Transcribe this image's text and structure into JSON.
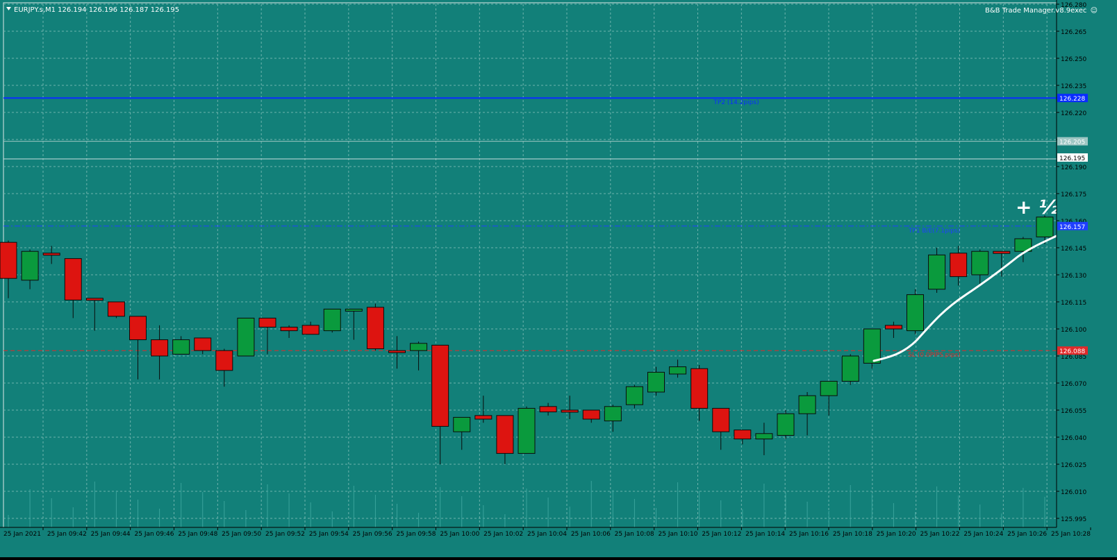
{
  "header": {
    "symbol_info": "EURJPY.s,M1  126.194 126.196 126.187 126.195",
    "ea_label": "B&B Trade Manager.v8.9exec",
    "smiley": "☺"
  },
  "colors": {
    "background": "#128079",
    "grid": "#6fb3ad",
    "bull": "#0a9a3d",
    "bear": "#dd1410",
    "wick": "#0a0a0a",
    "tp2_line": "#0a2cff",
    "tp1_line": "#1f3fff",
    "sl_line": "#e02a2a",
    "axis_text": "#000000",
    "pen": "#ffffff"
  },
  "chart_data": {
    "type": "candlestick",
    "symbol": "EURJPY.s",
    "timeframe": "M1",
    "ylim": [
      125.99,
      126.28
    ],
    "y_ticks": [
      "126.280",
      "126.265",
      "126.250",
      "126.235",
      "126.220",
      "126.205",
      "126.190",
      "126.175",
      "126.160",
      "126.145",
      "126.130",
      "126.115",
      "126.100",
      "126.085",
      "126.070",
      "126.055",
      "126.040",
      "126.025",
      "126.010",
      "125.995"
    ],
    "x_labels": [
      "25 Jan 2021",
      "25 Jan 09:42",
      "25 Jan 09:44",
      "25 Jan 09:46",
      "25 Jan 09:48",
      "25 Jan 09:50",
      "25 Jan 09:52",
      "25 Jan 09:54",
      "25 Jan 09:56",
      "25 Jan 09:58",
      "25 Jan 10:00",
      "25 Jan 10:02",
      "25 Jan 10:04",
      "25 Jan 10:06",
      "25 Jan 10:08",
      "25 Jan 10:10",
      "25 Jan 10:12",
      "25 Jan 10:14",
      "25 Jan 10:16",
      "25 Jan 10:18",
      "25 Jan 10:20",
      "25 Jan 10:22",
      "25 Jan 10:24",
      "25 Jan 10:26",
      "25 Jan 10:28"
    ],
    "candles": [
      {
        "o": 126.148,
        "h": 126.149,
        "l": 126.117,
        "c": 126.128
      },
      {
        "o": 126.127,
        "h": 126.144,
        "l": 126.122,
        "c": 126.143
      },
      {
        "o": 126.142,
        "h": 126.146,
        "l": 126.136,
        "c": 126.141
      },
      {
        "o": 126.139,
        "h": 126.139,
        "l": 126.106,
        "c": 126.116
      },
      {
        "o": 126.117,
        "h": 126.117,
        "l": 126.099,
        "c": 126.116
      },
      {
        "o": 126.115,
        "h": 126.115,
        "l": 126.106,
        "c": 126.107
      },
      {
        "o": 126.107,
        "h": 126.107,
        "l": 126.072,
        "c": 126.094
      },
      {
        "o": 126.094,
        "h": 126.102,
        "l": 126.072,
        "c": 126.085
      },
      {
        "o": 126.086,
        "h": 126.096,
        "l": 126.086,
        "c": 126.094
      },
      {
        "o": 126.095,
        "h": 126.095,
        "l": 126.086,
        "c": 126.088
      },
      {
        "o": 126.088,
        "h": 126.089,
        "l": 126.068,
        "c": 126.077
      },
      {
        "o": 126.085,
        "h": 126.106,
        "l": 126.085,
        "c": 126.106
      },
      {
        "o": 126.106,
        "h": 126.106,
        "l": 126.086,
        "c": 126.101
      },
      {
        "o": 126.101,
        "h": 126.102,
        "l": 126.095,
        "c": 126.099
      },
      {
        "o": 126.102,
        "h": 126.104,
        "l": 126.097,
        "c": 126.097
      },
      {
        "o": 126.099,
        "h": 126.111,
        "l": 126.098,
        "c": 126.111
      },
      {
        "o": 126.111,
        "h": 126.111,
        "l": 126.094,
        "c": 126.111
      },
      {
        "o": 126.112,
        "h": 126.114,
        "l": 126.088,
        "c": 126.089
      },
      {
        "o": 126.088,
        "h": 126.096,
        "l": 126.078,
        "c": 126.087
      },
      {
        "o": 126.088,
        "h": 126.093,
        "l": 126.077,
        "c": 126.092
      },
      {
        "o": 126.091,
        "h": 126.091,
        "l": 126.025,
        "c": 126.046
      },
      {
        "o": 126.043,
        "h": 126.051,
        "l": 126.033,
        "c": 126.051
      },
      {
        "o": 126.052,
        "h": 126.063,
        "l": 126.048,
        "c": 126.05
      },
      {
        "o": 126.052,
        "h": 126.052,
        "l": 126.025,
        "c": 126.031
      },
      {
        "o": 126.031,
        "h": 126.057,
        "l": 126.031,
        "c": 126.056
      },
      {
        "o": 126.057,
        "h": 126.059,
        "l": 126.052,
        "c": 126.054
      },
      {
        "o": 126.055,
        "h": 126.063,
        "l": 126.05,
        "c": 126.054
      },
      {
        "o": 126.055,
        "h": 126.055,
        "l": 126.048,
        "c": 126.05
      },
      {
        "o": 126.049,
        "h": 126.058,
        "l": 126.043,
        "c": 126.057
      },
      {
        "o": 126.058,
        "h": 126.069,
        "l": 126.056,
        "c": 126.068
      },
      {
        "o": 126.065,
        "h": 126.079,
        "l": 126.063,
        "c": 126.076
      },
      {
        "o": 126.075,
        "h": 126.083,
        "l": 126.073,
        "c": 126.079
      },
      {
        "o": 126.078,
        "h": 126.08,
        "l": 126.049,
        "c": 126.056
      },
      {
        "o": 126.056,
        "h": 126.056,
        "l": 126.033,
        "c": 126.043
      },
      {
        "o": 126.044,
        "h": 126.044,
        "l": 126.036,
        "c": 126.039
      },
      {
        "o": 126.039,
        "h": 126.048,
        "l": 126.03,
        "c": 126.042
      },
      {
        "o": 126.041,
        "h": 126.055,
        "l": 126.039,
        "c": 126.053
      },
      {
        "o": 126.053,
        "h": 126.065,
        "l": 126.041,
        "c": 126.063
      },
      {
        "o": 126.063,
        "h": 126.07,
        "l": 126.052,
        "c": 126.071
      },
      {
        "o": 126.071,
        "h": 126.086,
        "l": 126.069,
        "c": 126.085
      },
      {
        "o": 126.081,
        "h": 126.1,
        "l": 126.078,
        "c": 126.1
      },
      {
        "o": 126.102,
        "h": 126.104,
        "l": 126.095,
        "c": 126.1
      },
      {
        "o": 126.099,
        "h": 126.122,
        "l": 126.097,
        "c": 126.119
      },
      {
        "o": 126.122,
        "h": 126.145,
        "l": 126.12,
        "c": 126.141
      },
      {
        "o": 126.142,
        "h": 126.146,
        "l": 126.124,
        "c": 126.129
      },
      {
        "o": 126.13,
        "h": 126.144,
        "l": 126.125,
        "c": 126.143
      },
      {
        "o": 126.143,
        "h": 126.143,
        "l": 126.129,
        "c": 126.142
      },
      {
        "o": 126.143,
        "h": 126.151,
        "l": 126.137,
        "c": 126.15
      },
      {
        "o": 126.151,
        "h": 126.163,
        "l": 126.147,
        "c": 126.162
      }
    ],
    "levels": [
      {
        "name": "TP2",
        "label": "TP2 (14.2pips)",
        "price": 126.228,
        "price_label": "126.228",
        "style": "solid"
      },
      {
        "name": "TP1",
        "label": "TP1 B/E(7.1pips)",
        "price": 126.157,
        "price_label": "126.157",
        "style": "dashdot"
      },
      {
        "name": "SL",
        "label": "SL (0.0PIPS.pips)",
        "price": 126.088,
        "price_label": "126.088",
        "style": "dashed"
      }
    ],
    "bid_line": {
      "price": 126.195,
      "price_label": "126.195"
    },
    "ask_line": {
      "price": 126.204,
      "price_label": "126.205"
    },
    "annotation": {
      "text": "+ ½ %"
    },
    "grid": true
  }
}
